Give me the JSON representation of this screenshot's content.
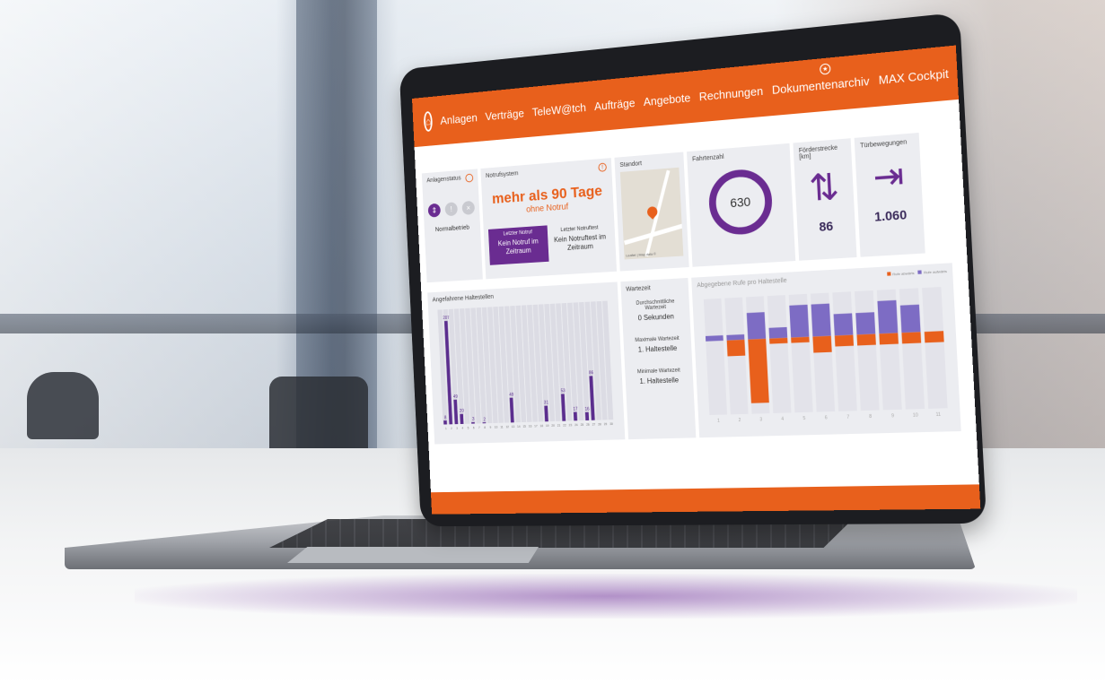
{
  "nav": {
    "items": [
      "Anlagen",
      "Verträge",
      "TeleW@tch",
      "Aufträge",
      "Angebote",
      "Rechnungen",
      "Dokumentenarchiv",
      "MAX Cockpit"
    ]
  },
  "anlagenstatus": {
    "title": "Anlagenstatus",
    "status_text": "Normalbetrieb"
  },
  "notruf": {
    "title": "Notrufsystem",
    "headline": "mehr als 90 Tage",
    "subline": "ohne Notruf",
    "last_call_label": "Letzter Notruf",
    "last_call_value": "Kein Notruf im Zeitraum",
    "last_test_label": "Letzter Notruftest",
    "last_test_value": "Kein Notruftest im Zeitraum"
  },
  "standort": {
    "title": "Standort",
    "map_credit": "Leaflet | Map data ©"
  },
  "fahrtenzahl": {
    "title": "Fahrtenzahl",
    "value": "630"
  },
  "foerderstrecke": {
    "title": "Förderstrecke [km]",
    "value": "86"
  },
  "tuerbewegungen": {
    "title": "Türbewegungen",
    "value": "1.060"
  },
  "haltestellen": {
    "title": "Angefahrene Haltestellen"
  },
  "wartezeit": {
    "title": "Wartezeit",
    "avg_label": "Durchschnittliche Wartezeit",
    "avg_value": "0 Sekunden",
    "max_label": "Maximale Wartezeit",
    "max_value": "1. Haltestelle",
    "min_label": "Minimale Wartezeit",
    "min_value": "1. Haltestelle"
  },
  "rufe": {
    "title": "Abgegebene Rufe pro Haltestelle"
  },
  "colors": {
    "accent": "#e8601c",
    "purple": "#6a2c91",
    "card": "#ecedf1"
  },
  "chart_data": [
    {
      "type": "bar",
      "title": "Angefahrene Haltestellen",
      "categories": [
        1,
        2,
        3,
        4,
        5,
        6,
        7,
        8,
        9,
        10,
        11,
        12,
        13,
        14,
        15,
        16,
        17,
        18,
        19,
        20,
        21,
        22,
        23,
        24,
        25,
        26,
        27,
        28,
        29,
        30
      ],
      "values": [
        8,
        207,
        49,
        20,
        0,
        3,
        0,
        2,
        0,
        0,
        0,
        0,
        49,
        0,
        0,
        0,
        0,
        0,
        31,
        0,
        0,
        53,
        0,
        17,
        0,
        16,
        86,
        0,
        0,
        0
      ],
      "ylim": [
        0,
        220
      ]
    },
    {
      "type": "bar",
      "title": "Abgegebene Rufe pro Haltestelle",
      "categories": [
        "1",
        "2",
        "3",
        "4",
        "5",
        "6",
        "7",
        "8",
        "9",
        "10",
        "11"
      ],
      "series": [
        {
          "name": "Rufe abwärts",
          "values": [
            0,
            -3,
            -12,
            -1,
            -1,
            -3,
            -2,
            -2,
            -2,
            -2,
            -2
          ]
        },
        {
          "name": "Rufe aufwärts",
          "values": [
            1,
            1,
            5,
            2,
            6,
            6,
            4,
            4,
            6,
            5,
            0
          ]
        }
      ],
      "ylim": [
        -14,
        8
      ]
    }
  ]
}
